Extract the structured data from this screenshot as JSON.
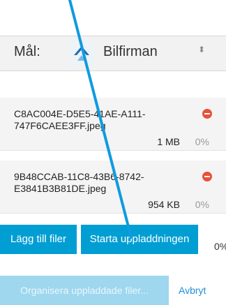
{
  "target": {
    "label": "Mål:",
    "value": "Bilfirman",
    "icon": "app-logo-icon",
    "chevron": "⬍"
  },
  "files": [
    {
      "name": "C8AC004E-D5E5-41AE-A111-747F6CAEE3FF.jpeg",
      "size": "1 MB",
      "progress": "0%"
    },
    {
      "name": "9B48CCAB-11C8-43B6-8742-E3841B3B81DE.jpeg",
      "size": "954 KB",
      "progress": "0%"
    }
  ],
  "actions": {
    "add_label": "Lägg till filer",
    "start_label": "Starta uppladdningen",
    "total_progress": "0%",
    "organize_label": "Organisera uppladdade filer...",
    "cancel_label": "Avbryt"
  },
  "colors": {
    "primary": "#009ed3",
    "primary_disabled": "#9ed7ee",
    "remove": "#e8503a",
    "link": "#1f8fd6"
  }
}
